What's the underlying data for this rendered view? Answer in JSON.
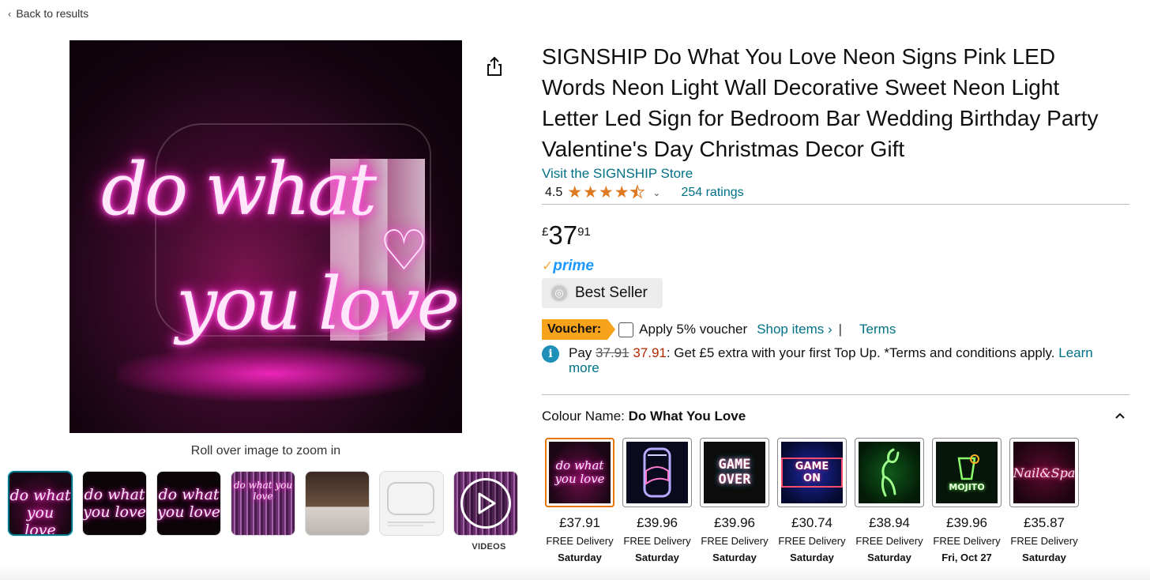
{
  "nav": {
    "back_label": "Back to results"
  },
  "gallery": {
    "main_image_text": [
      "do what",
      "you love"
    ],
    "zoom_hint": "Roll over image to zoom in",
    "thumb_text": [
      "do what you love",
      "do what you love",
      "do what you love",
      "do what you love",
      "",
      "",
      ""
    ],
    "videos_label": "VIDEOS"
  },
  "product": {
    "title": "SIGNSHIP Do What You Love Neon Signs Pink LED Words Neon Light Wall Decorative Sweet Neon Light Letter Led Sign for Bedroom Bar Wedding Birthday Party Valentine's Day Christmas Decor Gift",
    "store_link": "Visit the SIGNSHIP Store",
    "rating_value": "4.5",
    "rating_count": "254 ratings",
    "stars_filled": 4.5
  },
  "price": {
    "currency": "£",
    "whole": "37",
    "fraction": "91"
  },
  "prime": {
    "label": "prime"
  },
  "badge": {
    "label": "Best Seller"
  },
  "voucher": {
    "tag": "Voucher:",
    "apply_label": "Apply 5% voucher",
    "shop_items": "Shop items ›",
    "separator": "|",
    "terms": "Terms"
  },
  "topup": {
    "prefix": "Pay",
    "old_price": "37.91",
    "new_price": "37.91",
    "message": ": Get £5 extra with your first Top Up. *Terms and conditions apply.",
    "learn_more": "Learn more"
  },
  "colour": {
    "label": "Colour Name:",
    "value": "Do What You Love"
  },
  "swatches": [
    {
      "name": "do what you love",
      "price": "£37.91",
      "delivery": "FREE Delivery",
      "day": "Saturday",
      "selected": true
    },
    {
      "name": "can",
      "price": "£39.96",
      "delivery": "FREE Delivery",
      "day": "Saturday"
    },
    {
      "name": "GAME OVER",
      "price": "£39.96",
      "delivery": "FREE Delivery",
      "day": "Saturday"
    },
    {
      "name": "GAME ON",
      "price": "£30.74",
      "delivery": "FREE Delivery",
      "day": "Saturday"
    },
    {
      "name": "dancer",
      "price": "£38.94",
      "delivery": "FREE Delivery",
      "day": "Saturday"
    },
    {
      "name": "MOJITO",
      "price": "£39.96",
      "delivery": "FREE Delivery",
      "day": "Fri, Oct 27"
    },
    {
      "name": "Nail&Spa",
      "price": "£35.87",
      "delivery": "FREE Delivery",
      "day": "Saturday"
    }
  ],
  "colors": {
    "link": "#007185",
    "accent_orange": "#e77600",
    "star": "#de7921",
    "voucher": "#f7a21b",
    "price_red": "#b12704",
    "prime_blue": "#1a98ff"
  }
}
